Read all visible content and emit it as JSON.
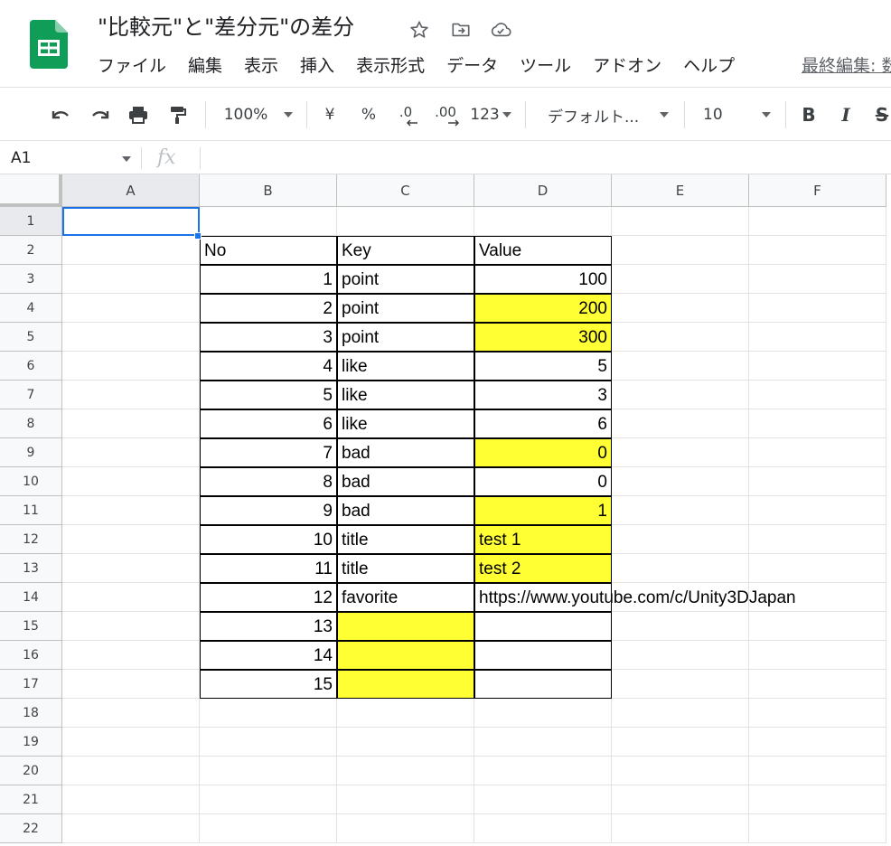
{
  "header": {
    "title": "\"比較元\"と\"差分元\"の差分",
    "last_edit": "最終編集: 数",
    "menu": [
      "ファイル",
      "編集",
      "表示",
      "挿入",
      "表示形式",
      "データ",
      "ツール",
      "アドオン",
      "ヘルプ"
    ],
    "icons": [
      "star-icon",
      "move-to-folder-icon",
      "cloud-status-icon"
    ]
  },
  "toolbar": {
    "zoom": "100%",
    "currency": "¥",
    "percent": "%",
    "decrease_decimal": ".0",
    "increase_decimal": ".00",
    "number_format": "123",
    "font": "デフォルト...",
    "font_size": "10",
    "bold": "B",
    "italic": "I",
    "strikethrough": "S"
  },
  "formula_bar": {
    "name_box": "A1",
    "fx": "fx",
    "value": ""
  },
  "sheet": {
    "columns": [
      "A",
      "B",
      "C",
      "D",
      "E",
      "F"
    ],
    "rows": [
      "1",
      "2",
      "3",
      "4",
      "5",
      "6",
      "7",
      "8",
      "9",
      "10",
      "11",
      "12",
      "13",
      "14",
      "15",
      "16",
      "17",
      "18",
      "19",
      "20",
      "21",
      "22"
    ],
    "selected_cell": "A1",
    "highlight_color": "#ffff33",
    "table": {
      "headers": [
        "No",
        "Key",
        "Value"
      ],
      "rows": [
        {
          "no": "1",
          "key": "point",
          "value": "100",
          "key_hl": false,
          "value_hl": false,
          "value_num": true
        },
        {
          "no": "2",
          "key": "point",
          "value": "200",
          "key_hl": false,
          "value_hl": true,
          "value_num": true
        },
        {
          "no": "3",
          "key": "point",
          "value": "300",
          "key_hl": false,
          "value_hl": true,
          "value_num": true
        },
        {
          "no": "4",
          "key": "like",
          "value": "5",
          "key_hl": false,
          "value_hl": false,
          "value_num": true
        },
        {
          "no": "5",
          "key": "like",
          "value": "3",
          "key_hl": false,
          "value_hl": false,
          "value_num": true
        },
        {
          "no": "6",
          "key": "like",
          "value": "6",
          "key_hl": false,
          "value_hl": false,
          "value_num": true
        },
        {
          "no": "7",
          "key": "bad",
          "value": "0",
          "key_hl": false,
          "value_hl": true,
          "value_num": true
        },
        {
          "no": "8",
          "key": "bad",
          "value": "0",
          "key_hl": false,
          "value_hl": false,
          "value_num": true
        },
        {
          "no": "9",
          "key": "bad",
          "value": "1",
          "key_hl": false,
          "value_hl": true,
          "value_num": true
        },
        {
          "no": "10",
          "key": "title",
          "value": "test 1",
          "key_hl": false,
          "value_hl": true,
          "value_num": false
        },
        {
          "no": "11",
          "key": "title",
          "value": "test 2",
          "key_hl": false,
          "value_hl": true,
          "value_num": false
        },
        {
          "no": "12",
          "key": "favorite",
          "value": "https://www.youtube.com/c/Unity3DJapan",
          "key_hl": false,
          "value_hl": false,
          "value_num": false
        },
        {
          "no": "13",
          "key": "",
          "value": "",
          "key_hl": true,
          "value_hl": false,
          "value_num": false
        },
        {
          "no": "14",
          "key": "",
          "value": "",
          "key_hl": true,
          "value_hl": false,
          "value_num": false
        },
        {
          "no": "15",
          "key": "",
          "value": "",
          "key_hl": true,
          "value_hl": false,
          "value_num": false
        }
      ]
    }
  }
}
